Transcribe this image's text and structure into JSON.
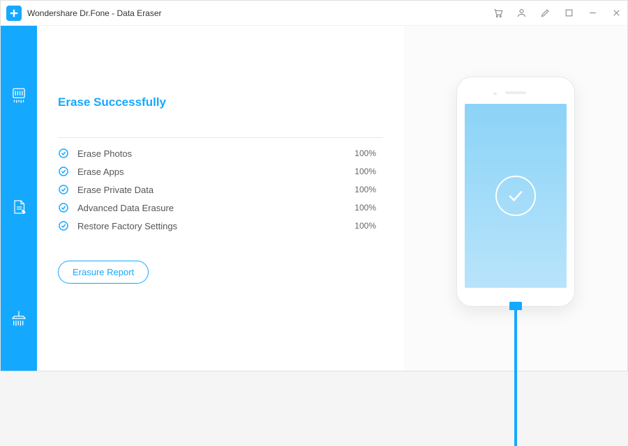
{
  "app": {
    "title": "Wondershare Dr.Fone - Data Eraser"
  },
  "main": {
    "heading": "Erase Successfully",
    "tasks": [
      {
        "label": "Erase Photos",
        "percent": "100%"
      },
      {
        "label": "Erase Apps",
        "percent": "100%"
      },
      {
        "label": "Erase Private Data",
        "percent": "100%"
      },
      {
        "label": "Advanced Data Erasure",
        "percent": "100%"
      },
      {
        "label": "Restore Factory Settings",
        "percent": "100%"
      }
    ],
    "report_button": "Erasure Report"
  },
  "colors": {
    "accent": "#14a9ff"
  }
}
